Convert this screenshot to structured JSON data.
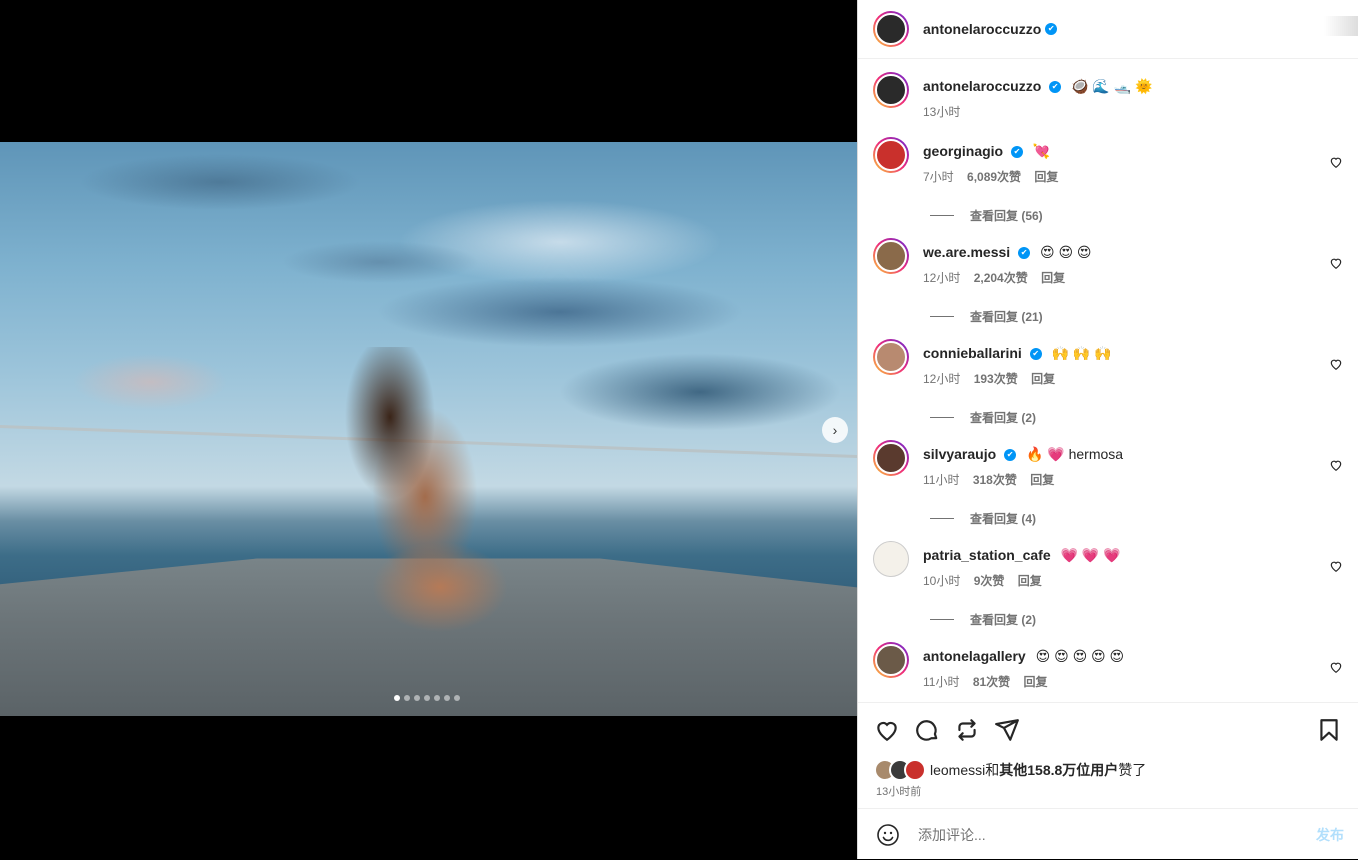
{
  "post": {
    "username": "antonelaroccuzzo",
    "caption_emoji": "🥥 🌊 🛥️ 🌞",
    "caption_time": "13小时",
    "carousel_count": 7,
    "carousel_active": 0
  },
  "comments": [
    {
      "username": "georginagio",
      "verified": true,
      "text": "💘",
      "time": "7小时",
      "likes": "6,089次赞",
      "reply": "回复",
      "view_replies": "查看回复 (56)"
    },
    {
      "username": "we.are.messi",
      "verified": true,
      "text": "😍 😍 😍",
      "time": "12小时",
      "likes": "2,204次赞",
      "reply": "回复",
      "view_replies": "查看回复 (21)"
    },
    {
      "username": "connieballarini",
      "verified": true,
      "text": "🙌 🙌 🙌",
      "time": "12小时",
      "likes": "193次赞",
      "reply": "回复",
      "view_replies": "查看回复 (2)"
    },
    {
      "username": "silvyaraujo",
      "verified": true,
      "text": "🔥 💗 hermosa",
      "time": "11小时",
      "likes": "318次赞",
      "reply": "回复",
      "view_replies": "查看回复 (4)"
    },
    {
      "username": "patria_station_cafe",
      "verified": false,
      "text": "💗 💗 💗",
      "time": "10小时",
      "likes": "9次赞",
      "reply": "回复",
      "view_replies": "查看回复 (2)"
    },
    {
      "username": "antonelagallery",
      "verified": true,
      "text": "😍 😍 😍 😍 😍",
      "time": "11小时",
      "likes": "81次赞",
      "reply": "回复",
      "view_replies": ""
    }
  ],
  "likes": {
    "liker": "leomessi",
    "conjunction": "和",
    "others": "其他158.8万位用户",
    "suffix": "赞了"
  },
  "posted_time": "13小时前",
  "compose": {
    "placeholder": "添加评论...",
    "post_label": "发布"
  },
  "colors": {
    "accent": "#0095f6",
    "post_disabled": "#b2dffc",
    "secondary_text": "#737373"
  },
  "icons": [
    "heart-icon",
    "comment-icon",
    "repost-icon",
    "share-icon",
    "bookmark-icon",
    "emoji-icon",
    "chevron-right-icon",
    "verified-badge-icon"
  ]
}
